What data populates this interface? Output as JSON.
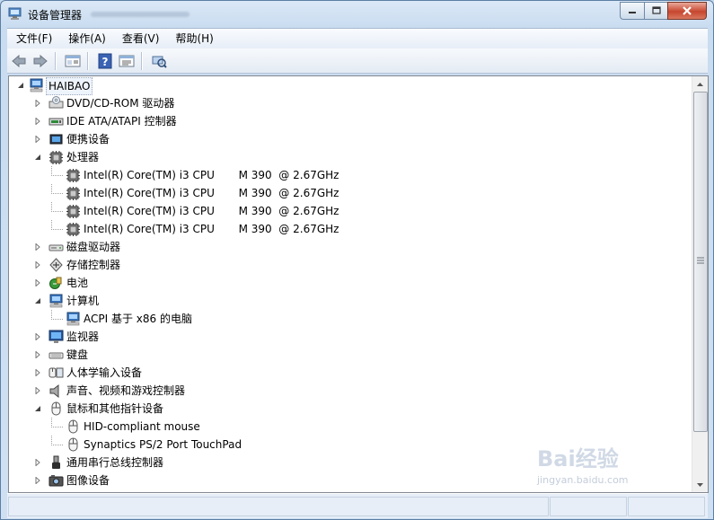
{
  "window": {
    "title": "设备管理器"
  },
  "menu": [
    "文件(F)",
    "操作(A)",
    "查看(V)",
    "帮助(H)"
  ],
  "toolbar": [
    "back-icon",
    "forward-icon",
    "properties-console-icon",
    "help-icon",
    "scan-hardware-icon",
    "update-driver-icon"
  ],
  "tree": {
    "root": "HAIBAO",
    "items": [
      {
        "label": "DVD/CD-ROM 驱动器",
        "level": 1,
        "expander": "collapsed",
        "icon": "dvd-drive-icon"
      },
      {
        "label": "IDE ATA/ATAPI 控制器",
        "level": 1,
        "expander": "collapsed",
        "icon": "ide-controller-icon"
      },
      {
        "label": "便携设备",
        "level": 1,
        "expander": "collapsed",
        "icon": "portable-device-icon"
      },
      {
        "label": "处理器",
        "level": 1,
        "expander": "expanded",
        "icon": "processor-icon"
      },
      {
        "label": "Intel(R) Core(TM) i3 CPU       M 390  @ 2.67GHz",
        "level": 2,
        "expander": "none",
        "icon": "processor-icon"
      },
      {
        "label": "Intel(R) Core(TM) i3 CPU       M 390  @ 2.67GHz",
        "level": 2,
        "expander": "none",
        "icon": "processor-icon"
      },
      {
        "label": "Intel(R) Core(TM) i3 CPU       M 390  @ 2.67GHz",
        "level": 2,
        "expander": "none",
        "icon": "processor-icon"
      },
      {
        "label": "Intel(R) Core(TM) i3 CPU       M 390  @ 2.67GHz",
        "level": 2,
        "expander": "none",
        "icon": "processor-icon"
      },
      {
        "label": "磁盘驱动器",
        "level": 1,
        "expander": "collapsed",
        "icon": "disk-drive-icon"
      },
      {
        "label": "存储控制器",
        "level": 1,
        "expander": "collapsed",
        "icon": "storage-controller-icon"
      },
      {
        "label": "电池",
        "level": 1,
        "expander": "collapsed",
        "icon": "battery-icon"
      },
      {
        "label": "计算机",
        "level": 1,
        "expander": "expanded",
        "icon": "computer-icon"
      },
      {
        "label": "ACPI 基于 x86 的电脑",
        "level": 2,
        "expander": "none",
        "icon": "computer-icon"
      },
      {
        "label": "监视器",
        "level": 1,
        "expander": "collapsed",
        "icon": "monitor-icon"
      },
      {
        "label": "键盘",
        "level": 1,
        "expander": "collapsed",
        "icon": "keyboard-icon"
      },
      {
        "label": "人体学输入设备",
        "level": 1,
        "expander": "collapsed",
        "icon": "hid-icon"
      },
      {
        "label": "声音、视频和游戏控制器",
        "level": 1,
        "expander": "collapsed",
        "icon": "speaker-icon"
      },
      {
        "label": "鼠标和其他指针设备",
        "level": 1,
        "expander": "expanded",
        "icon": "mouse-icon"
      },
      {
        "label": "HID-compliant mouse",
        "level": 2,
        "expander": "none",
        "icon": "mouse-icon"
      },
      {
        "label": "Synaptics PS/2 Port TouchPad",
        "level": 2,
        "expander": "none",
        "icon": "mouse-icon"
      },
      {
        "label": "通用串行总线控制器",
        "level": 1,
        "expander": "collapsed",
        "icon": "usb-icon"
      },
      {
        "label": "图像设备",
        "level": 1,
        "expander": "collapsed",
        "icon": "camera-icon"
      }
    ]
  },
  "watermark": {
    "brand": "Bai经验",
    "url": "jingyan.baidu.com"
  }
}
